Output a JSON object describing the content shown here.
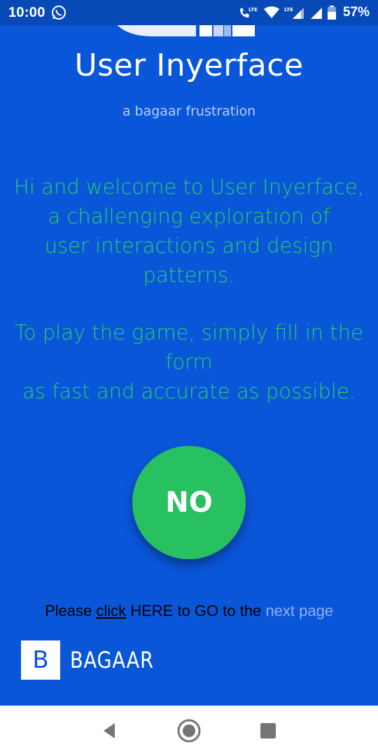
{
  "status_bar": {
    "time": "10:00",
    "battery_percent": "57%",
    "network_label_1": "LTE",
    "network_label_2": "LTE"
  },
  "header": {
    "title": "User Inyerface",
    "subtitle": "a bagaar frustration"
  },
  "intro": {
    "paragraph_1_lines": [
      "Hi and welcome to User Inyerface,",
      "a challenging exploration of",
      "user interactions and design",
      "patterns."
    ],
    "paragraph_2_lines": [
      "To play the game, simply fill in the",
      "form",
      "as fast and accurate as possible."
    ]
  },
  "main": {
    "no_button_label": "NO"
  },
  "navigation_line": {
    "prefix": "Please ",
    "click_text": "click",
    "middle": " HERE to GO to the ",
    "next_text": "next page"
  },
  "brand": {
    "letter": "B",
    "name": "BAGAAR"
  },
  "colors": {
    "background": "#0a56d9",
    "intro_text": "#2ecb63",
    "button_green": "#28c162",
    "link_light_blue": "#8fb0ee"
  }
}
